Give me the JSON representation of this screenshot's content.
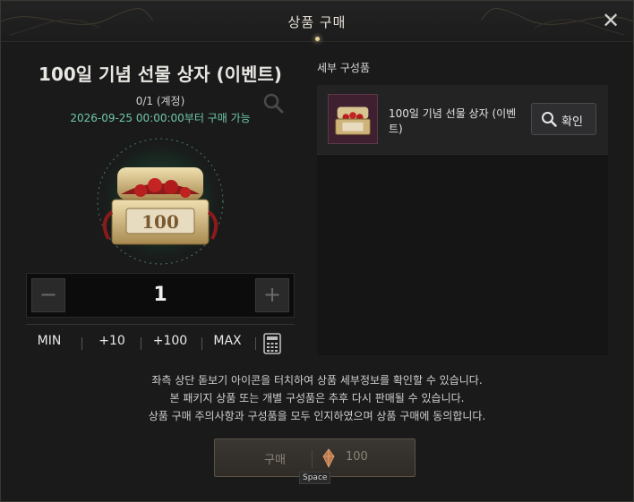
{
  "dialog": {
    "title": "상품 구매",
    "close_label": "✕"
  },
  "product": {
    "name": "100일 기념 선물 상자 (이벤트)",
    "purchase_limit": "0/1 (계정)",
    "availability": "2026-09-25 00:00:00부터 구매 가능",
    "zoom_icon": "magnifier-icon",
    "image_badge_text": "100"
  },
  "quantity": {
    "value": "1",
    "minus_label": "−",
    "plus_label": "+"
  },
  "quick_buttons": {
    "min": "MIN",
    "plus10": "+10",
    "plus100": "+100",
    "max": "MAX",
    "calculator_icon": "calculator-icon"
  },
  "components": {
    "title": "세부 구성품",
    "items": [
      {
        "name": "100일 기념 선물 상자 (이벤트)",
        "confirm_label": "확인",
        "confirm_icon": "magnifier-icon"
      }
    ]
  },
  "notices": [
    "좌측 상단 돋보기 아이콘을 터치하여 상품 세부정보를 확인할 수 있습니다.",
    "본 패키지 상품 또는 개별 구성품은 추후 다시 판매될 수 있습니다.",
    "상품 구매 주의사항과 구성품을 모두 인지하였으며 상품 구매에 동의합니다."
  ],
  "purchase": {
    "label": "구매",
    "price": "100",
    "currency_icon": "crystal-currency-icon",
    "key_hint": "Space"
  },
  "colors": {
    "accent_text": "#6fc8a8",
    "panel_bg": "#1a1a1b",
    "buy_button": "#3a3631"
  }
}
